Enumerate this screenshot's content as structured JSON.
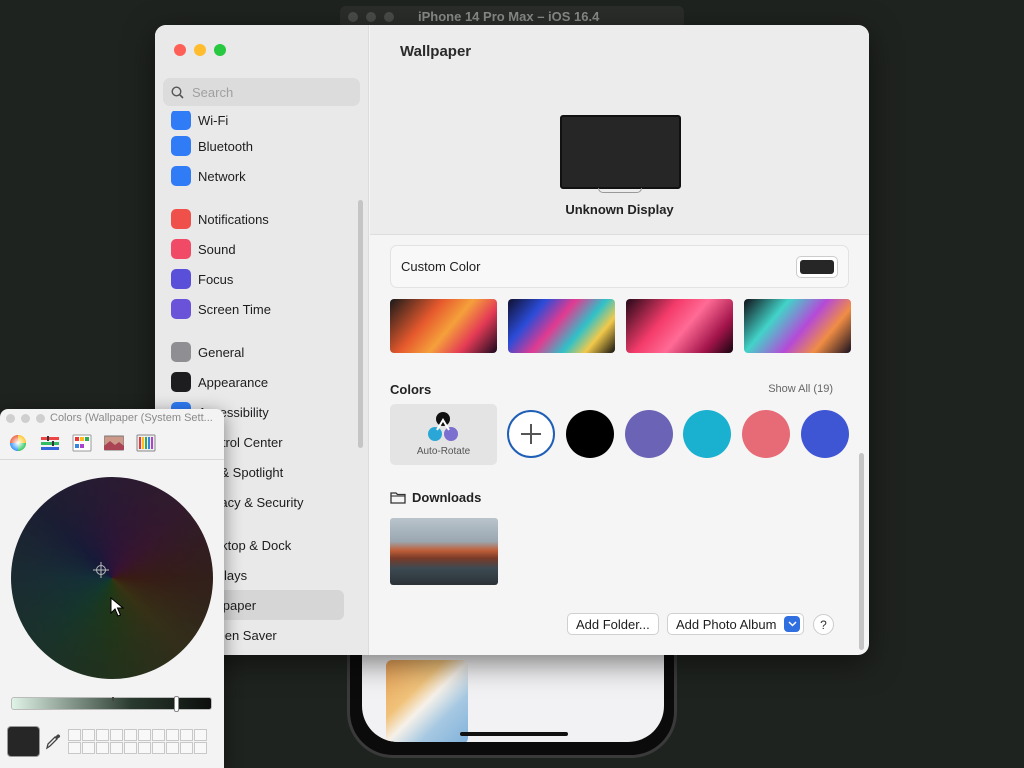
{
  "simulator": {
    "title": "iPhone 14 Pro Max – iOS 16.4"
  },
  "settings": {
    "search_placeholder": "Search",
    "sidebar": {
      "items": [
        {
          "label": "Wi-Fi",
          "icon": "wifi-icon",
          "color": "#2f7cf6"
        },
        {
          "label": "Bluetooth",
          "icon": "bluetooth-icon",
          "color": "#2f7cf6"
        },
        {
          "label": "Network",
          "icon": "globe-icon",
          "color": "#2f7cf6"
        },
        {
          "label": "Notifications",
          "icon": "bell-icon",
          "color": "#f0504a"
        },
        {
          "label": "Sound",
          "icon": "speaker-icon",
          "color": "#f04a66"
        },
        {
          "label": "Focus",
          "icon": "moon-icon",
          "color": "#5a4fd8"
        },
        {
          "label": "Screen Time",
          "icon": "hourglass-icon",
          "color": "#6a52d9"
        },
        {
          "label": "General",
          "icon": "gear-icon",
          "color": "#8e8e93"
        },
        {
          "label": "Appearance",
          "icon": "appearance-icon",
          "color": "#1d1d1f"
        },
        {
          "label": "Accessibility",
          "icon": "accessibility-icon",
          "color": "#2f7cf6"
        },
        {
          "label": "Control Center",
          "icon": "control-center-icon",
          "color": "#8e8e93"
        },
        {
          "label": "Siri & Spotlight",
          "icon": "siri-icon",
          "color": "#6c3ad0"
        },
        {
          "label": "Privacy & Security",
          "icon": "hand-icon",
          "color": "#2f7cf6"
        },
        {
          "label": "Desktop & Dock",
          "icon": "dock-icon",
          "color": "#1d1d1f"
        },
        {
          "label": "Displays",
          "icon": "display-icon",
          "color": "#2f7cf6"
        },
        {
          "label": "Wallpaper",
          "icon": "wallpaper-icon",
          "color": "#3fa8e0"
        },
        {
          "label": "Screen Saver",
          "icon": "screensaver-icon",
          "color": "#49b6d8"
        }
      ],
      "selected": "Wallpaper"
    },
    "main": {
      "title": "Wallpaper",
      "display_name": "Unknown Display",
      "custom_color_label": "Custom Color",
      "custom_color_value": "#262626",
      "colors_heading": "Colors",
      "show_all": "Show All (19)",
      "auto_rotate_label": "Auto-Rotate",
      "color_swatches": [
        "#000000",
        "#6b63b5",
        "#1ab0d0",
        "#e76a77",
        "#3f56d4"
      ],
      "downloads_heading": "Downloads",
      "add_folder": "Add Folder...",
      "add_photo_album": "Add Photo Album",
      "help": "?"
    }
  },
  "colors_panel": {
    "title": "Colors (Wallpaper (System Sett...",
    "tools": [
      "color-wheel-icon",
      "sliders-icon",
      "palettes-icon",
      "image-palette-icon",
      "pencils-icon"
    ],
    "current_color": "#262626",
    "brightness": 0.77
  }
}
